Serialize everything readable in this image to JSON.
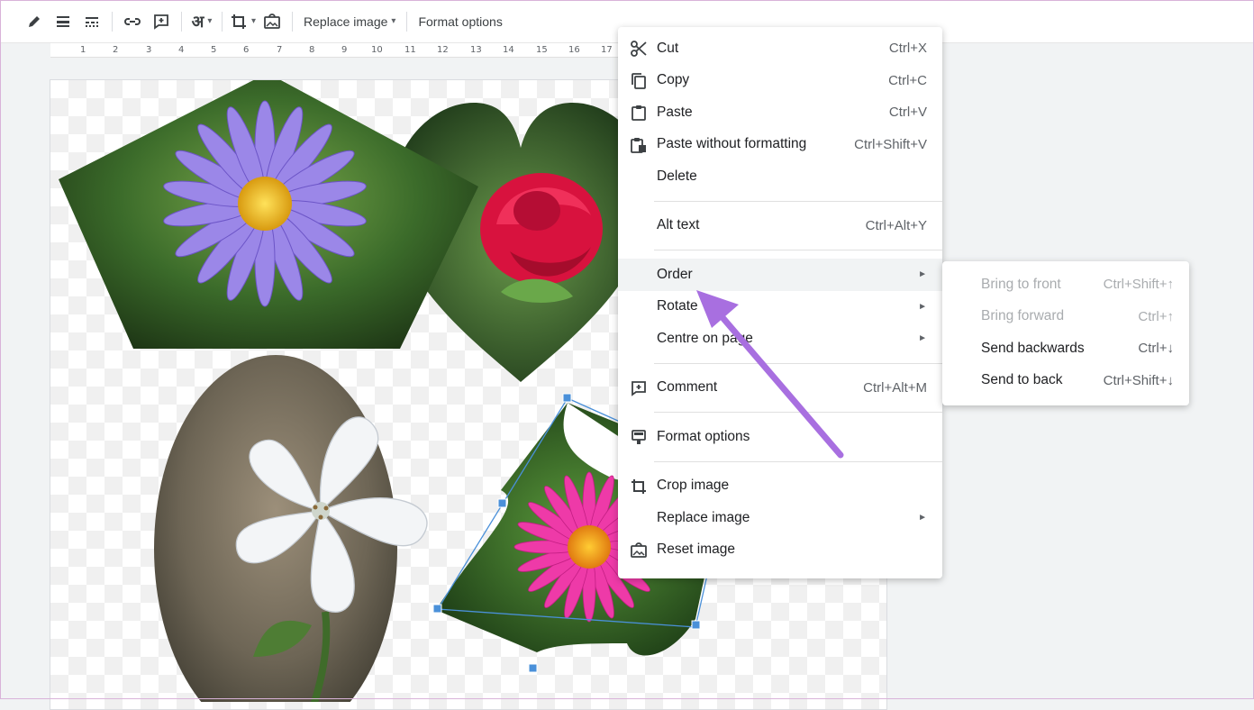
{
  "toolbar": {
    "replace_image": "Replace image",
    "format_options": "Format options",
    "lang_glyph": "अ"
  },
  "ruler": {
    "labels": [
      "1",
      "2",
      "3",
      "4",
      "5",
      "6",
      "7",
      "8",
      "9",
      "10",
      "11",
      "12",
      "13",
      "14",
      "15",
      "16",
      "17"
    ]
  },
  "context_menu": {
    "items": [
      {
        "label": "Cut",
        "shortcut": "Ctrl+X",
        "icon": "scissors-icon"
      },
      {
        "label": "Copy",
        "shortcut": "Ctrl+C",
        "icon": "copy-icon"
      },
      {
        "label": "Paste",
        "shortcut": "Ctrl+V",
        "icon": "clipboard-icon"
      },
      {
        "label": "Paste without formatting",
        "shortcut": "Ctrl+Shift+V",
        "icon": "paste-plain-icon"
      },
      {
        "label": "Delete",
        "shortcut": ""
      },
      {
        "label": "Alt text",
        "shortcut": "Ctrl+Alt+Y"
      },
      {
        "label": "Order",
        "submenu": true
      },
      {
        "label": "Rotate",
        "submenu": true
      },
      {
        "label": "Centre on page",
        "submenu": true
      },
      {
        "label": "Comment",
        "shortcut": "Ctrl+Alt+M",
        "icon": "comment-icon"
      },
      {
        "label": "Format options",
        "icon": "format-options-icon"
      },
      {
        "label": "Crop image",
        "icon": "crop-icon"
      },
      {
        "label": "Replace image",
        "submenu": true
      },
      {
        "label": "Reset image",
        "icon": "reset-image-icon"
      }
    ],
    "submenu_arrow": "►"
  },
  "order_submenu": {
    "items": [
      {
        "label": "Bring to front",
        "shortcut": "Ctrl+Shift+↑",
        "disabled": true
      },
      {
        "label": "Bring forward",
        "shortcut": "Ctrl+↑",
        "disabled": true
      },
      {
        "label": "Send backwards",
        "shortcut": "Ctrl+↓",
        "disabled": false
      },
      {
        "label": "Send to back",
        "shortcut": "Ctrl+Shift+↓",
        "disabled": false
      }
    ]
  },
  "colors": {
    "annotation_arrow": "#a86fe0",
    "selection": "#1a73e8",
    "menu_highlight": "#f1f3f4"
  }
}
